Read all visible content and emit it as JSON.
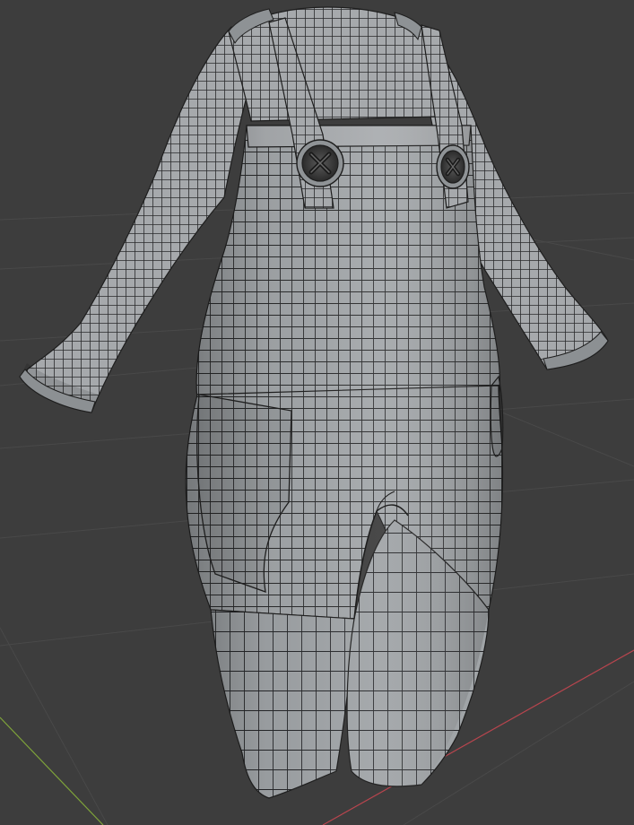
{
  "viewport": {
    "background_color": "#3d3d3d",
    "grid_color": "#4a4a4a",
    "x_axis_color": "#b8454e",
    "y_axis_color": "#7ea33a",
    "mesh_fill_color": "#a3a7aa",
    "mesh_wire_color": "#1c1c1c",
    "display_mode": "solid wireframe",
    "object": "overalls-with-long-sleeve-shirt"
  }
}
